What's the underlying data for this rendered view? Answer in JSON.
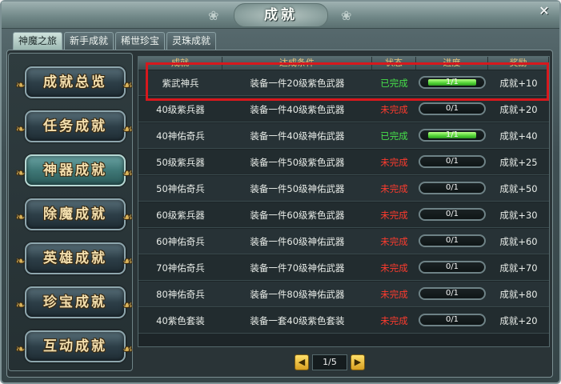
{
  "window": {
    "title": "成就"
  },
  "tabs": [
    {
      "label": "神魔之旅",
      "active": true
    },
    {
      "label": "新手成就",
      "active": false
    },
    {
      "label": "稀世珍宝",
      "active": false
    },
    {
      "label": "灵珠成就",
      "active": false
    }
  ],
  "sidebar": [
    {
      "label": "成就总览",
      "active": false
    },
    {
      "label": "任务成就",
      "active": false
    },
    {
      "label": "神器成就",
      "active": true
    },
    {
      "label": "除魔成就",
      "active": false
    },
    {
      "label": "英雄成就",
      "active": false
    },
    {
      "label": "珍宝成就",
      "active": false
    },
    {
      "label": "互动成就",
      "active": false
    }
  ],
  "table": {
    "headers": [
      "成就",
      "达成条件",
      "状态",
      "进度",
      "奖励"
    ],
    "rows": [
      {
        "name": "紫武神兵",
        "condition": "装备一件20级紫色武器",
        "status": "已完成",
        "done": true,
        "progress": "1/1",
        "fraction": 1,
        "reward": "成就+10"
      },
      {
        "name": "40级紫兵器",
        "condition": "装备一件40级紫色武器",
        "status": "未完成",
        "done": false,
        "progress": "0/1",
        "fraction": 0,
        "reward": "成就+20"
      },
      {
        "name": "40神佑奇兵",
        "condition": "装备一件40级神佑武器",
        "status": "已完成",
        "done": true,
        "progress": "1/1",
        "fraction": 1,
        "reward": "成就+40"
      },
      {
        "name": "50级紫兵器",
        "condition": "装备一件50级紫色武器",
        "status": "未完成",
        "done": false,
        "progress": "0/1",
        "fraction": 0,
        "reward": "成就+25"
      },
      {
        "name": "50神佑奇兵",
        "condition": "装备一件50级神佑武器",
        "status": "未完成",
        "done": false,
        "progress": "0/1",
        "fraction": 0,
        "reward": "成就+50"
      },
      {
        "name": "60级紫兵器",
        "condition": "装备一件60级紫色武器",
        "status": "未完成",
        "done": false,
        "progress": "0/1",
        "fraction": 0,
        "reward": "成就+30"
      },
      {
        "name": "60神佑奇兵",
        "condition": "装备一件60级神佑武器",
        "status": "未完成",
        "done": false,
        "progress": "0/1",
        "fraction": 0,
        "reward": "成就+60"
      },
      {
        "name": "70神佑奇兵",
        "condition": "装备一件70级神佑武器",
        "status": "未完成",
        "done": false,
        "progress": "0/1",
        "fraction": 0,
        "reward": "成就+70"
      },
      {
        "name": "80神佑奇兵",
        "condition": "装备一件80级神佑武器",
        "status": "未完成",
        "done": false,
        "progress": "0/1",
        "fraction": 0,
        "reward": "成就+80"
      },
      {
        "name": "40紫色套装",
        "condition": "装备一套40级紫色套装",
        "status": "未完成",
        "done": false,
        "progress": "0/1",
        "fraction": 0,
        "reward": "成就+20"
      }
    ]
  },
  "pager": {
    "label": "1/5"
  }
}
